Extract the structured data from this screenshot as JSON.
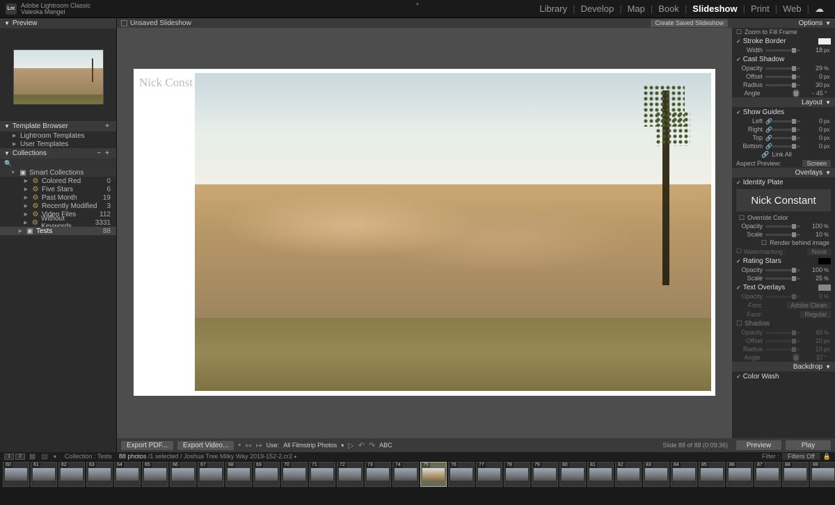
{
  "app": {
    "name": "Adobe Lightroom Classic",
    "catalog": "Valeska Mangel"
  },
  "modules": [
    "Library",
    "Develop",
    "Map",
    "Book",
    "Slideshow",
    "Print",
    "Web"
  ],
  "active_module": "Slideshow",
  "left": {
    "preview_hdr": "Preview",
    "template_hdr": "Template Browser",
    "templates": [
      "Lightroom Templates",
      "User Templates"
    ],
    "collections_hdr": "Collections",
    "smart_hdr": "Smart Collections",
    "smart": [
      {
        "name": "Colored Red",
        "count": "0"
      },
      {
        "name": "Five Stars",
        "count": "6"
      },
      {
        "name": "Past Month",
        "count": "19"
      },
      {
        "name": "Recently Modified",
        "count": "3"
      },
      {
        "name": "Video Files",
        "count": "112"
      },
      {
        "name": "Without Keywords",
        "count": "3331"
      }
    ],
    "tests": {
      "name": "Tests",
      "count": "88"
    }
  },
  "center": {
    "unsaved": "Unsaved Slideshow",
    "create_btn": "Create Saved Slideshow",
    "identity_overlay": "Nick Const",
    "export_pdf": "Export PDF...",
    "export_video": "Export Video...",
    "use_label": "Use:",
    "use_value": "All Filmstrip Photos",
    "abc": "ABC",
    "slide_counter": "Slide 88 of 88 (0:09:36)"
  },
  "right": {
    "options_hdr": "Options",
    "zoom_fill": "Zoom to Fill Frame",
    "stroke_border": "Stroke Border",
    "width_lbl": "Width",
    "width_val": "18",
    "px": "px",
    "cast_shadow": "Cast Shadow",
    "opacity_lbl": "Opacity",
    "opacity_val": "29",
    "pct": "%",
    "offset_lbl": "Offset",
    "offset_val": "0",
    "radius_lbl": "Radius",
    "radius_val": "30",
    "angle_lbl": "Angle",
    "angle_val": "- 45",
    "deg": "°",
    "layout_hdr": "Layout",
    "show_guides": "Show Guides",
    "guides": [
      {
        "lbl": "Left",
        "val": "0"
      },
      {
        "lbl": "Right",
        "val": "0"
      },
      {
        "lbl": "Top",
        "val": "0"
      },
      {
        "lbl": "Bottom",
        "val": "0"
      }
    ],
    "link_all": "Link All",
    "aspect_preview": "Aspect Preview:",
    "aspect_value": "Screen",
    "overlays_hdr": "Overlays",
    "identity_plate": "Identity Plate",
    "identity_name": "Nick Constant",
    "override_color": "Override Color",
    "id_opacity": "100",
    "id_scale": "10",
    "scale_lbl": "Scale",
    "render_behind": "Render behind image",
    "watermarking": "Watermarking :",
    "watermark_val": "None",
    "rating_stars": "Rating Stars",
    "rs_opacity": "100",
    "rs_scale": "25",
    "text_overlays": "Text Overlays",
    "font_lbl": "Font:",
    "font_val": "Adobe Clean",
    "face_lbl": "Face:",
    "face_val": "Regular",
    "to_shadow": "Shadow",
    "to_opacity": "49",
    "to_offset": "10",
    "to_radius": "10",
    "to_angle": "37",
    "backdrop_hdr": "Backdrop",
    "color_wash": "Color Wash",
    "preview_btn": "Preview",
    "play_btn": "Play"
  },
  "filterbar": {
    "collection_label": "Collection :",
    "collection_value": "Tests",
    "count_text": "88 photos",
    "sel_text": "/1 selected / Joshua Tree Milky Way 2019-152-2.cr2",
    "filter_label": "Filter :",
    "filter_value": "Filters Off"
  },
  "filmstrip_start": 60
}
